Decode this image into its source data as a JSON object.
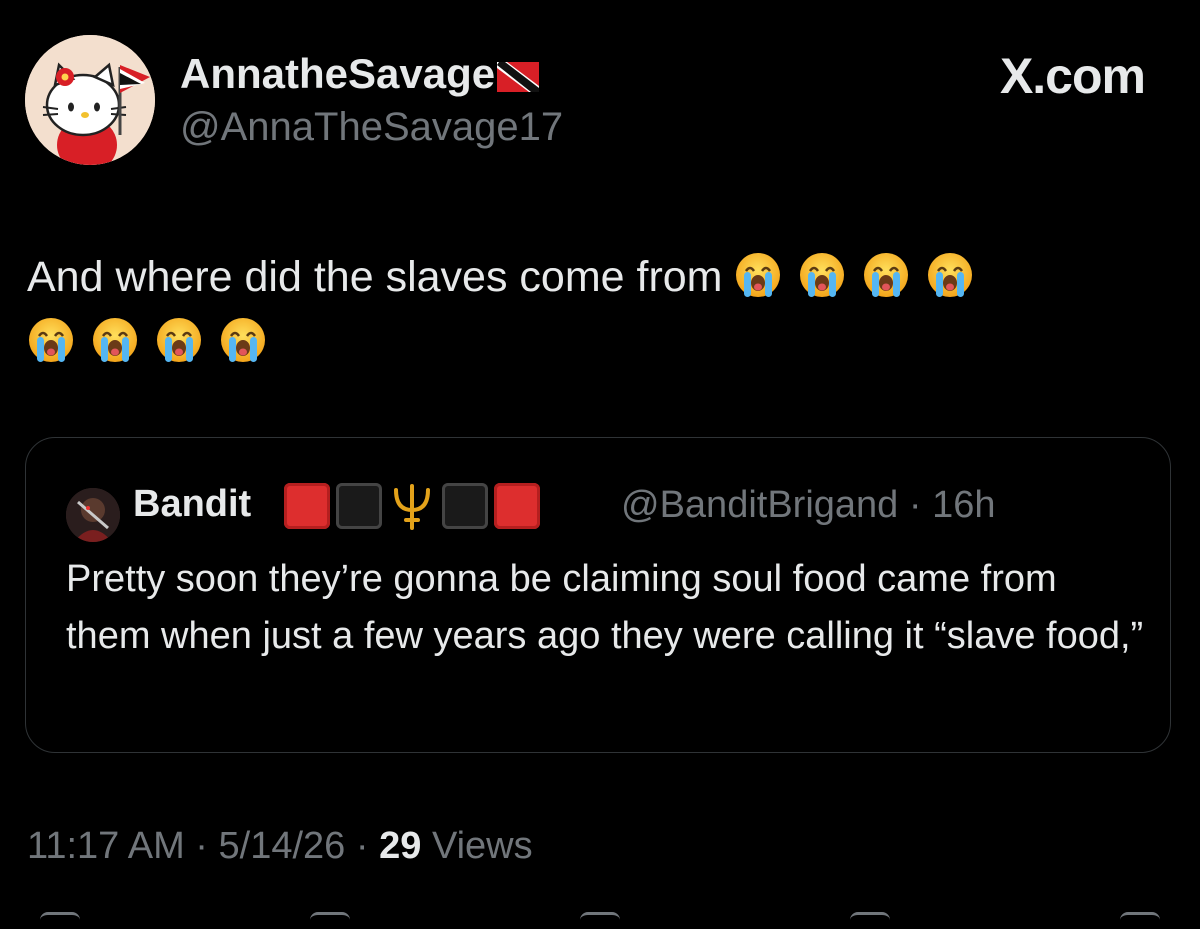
{
  "author": {
    "display_name": "AnnatheSavage",
    "handle": "@AnnaTheSavage17",
    "flag": "trinidad-and-tobago-flag",
    "avatar": "hello-kitty-avatar"
  },
  "brand": {
    "logo_text": "X.com"
  },
  "tweet": {
    "text": "And where did the slaves come from",
    "emoji_name": "loudly-crying-face",
    "emoji_count": 8
  },
  "quote": {
    "display_name": "Bandit",
    "badges": [
      "red-square",
      "black-square",
      "trident",
      "black-square",
      "red-square"
    ],
    "handle_time": "@BanditBrigand · 16h",
    "text": "Pretty soon they’re gonna be claiming soul food came from them when just a few years ago they were calling it “slave food,”"
  },
  "meta": {
    "time": "11:17 AM",
    "separator": "·",
    "date": "5/14/26",
    "views_count": "29",
    "views_label": "Views"
  },
  "colors": {
    "background": "#000000",
    "text": "#e7e9ea",
    "secondary": "#71767b",
    "border": "#2f3336"
  }
}
